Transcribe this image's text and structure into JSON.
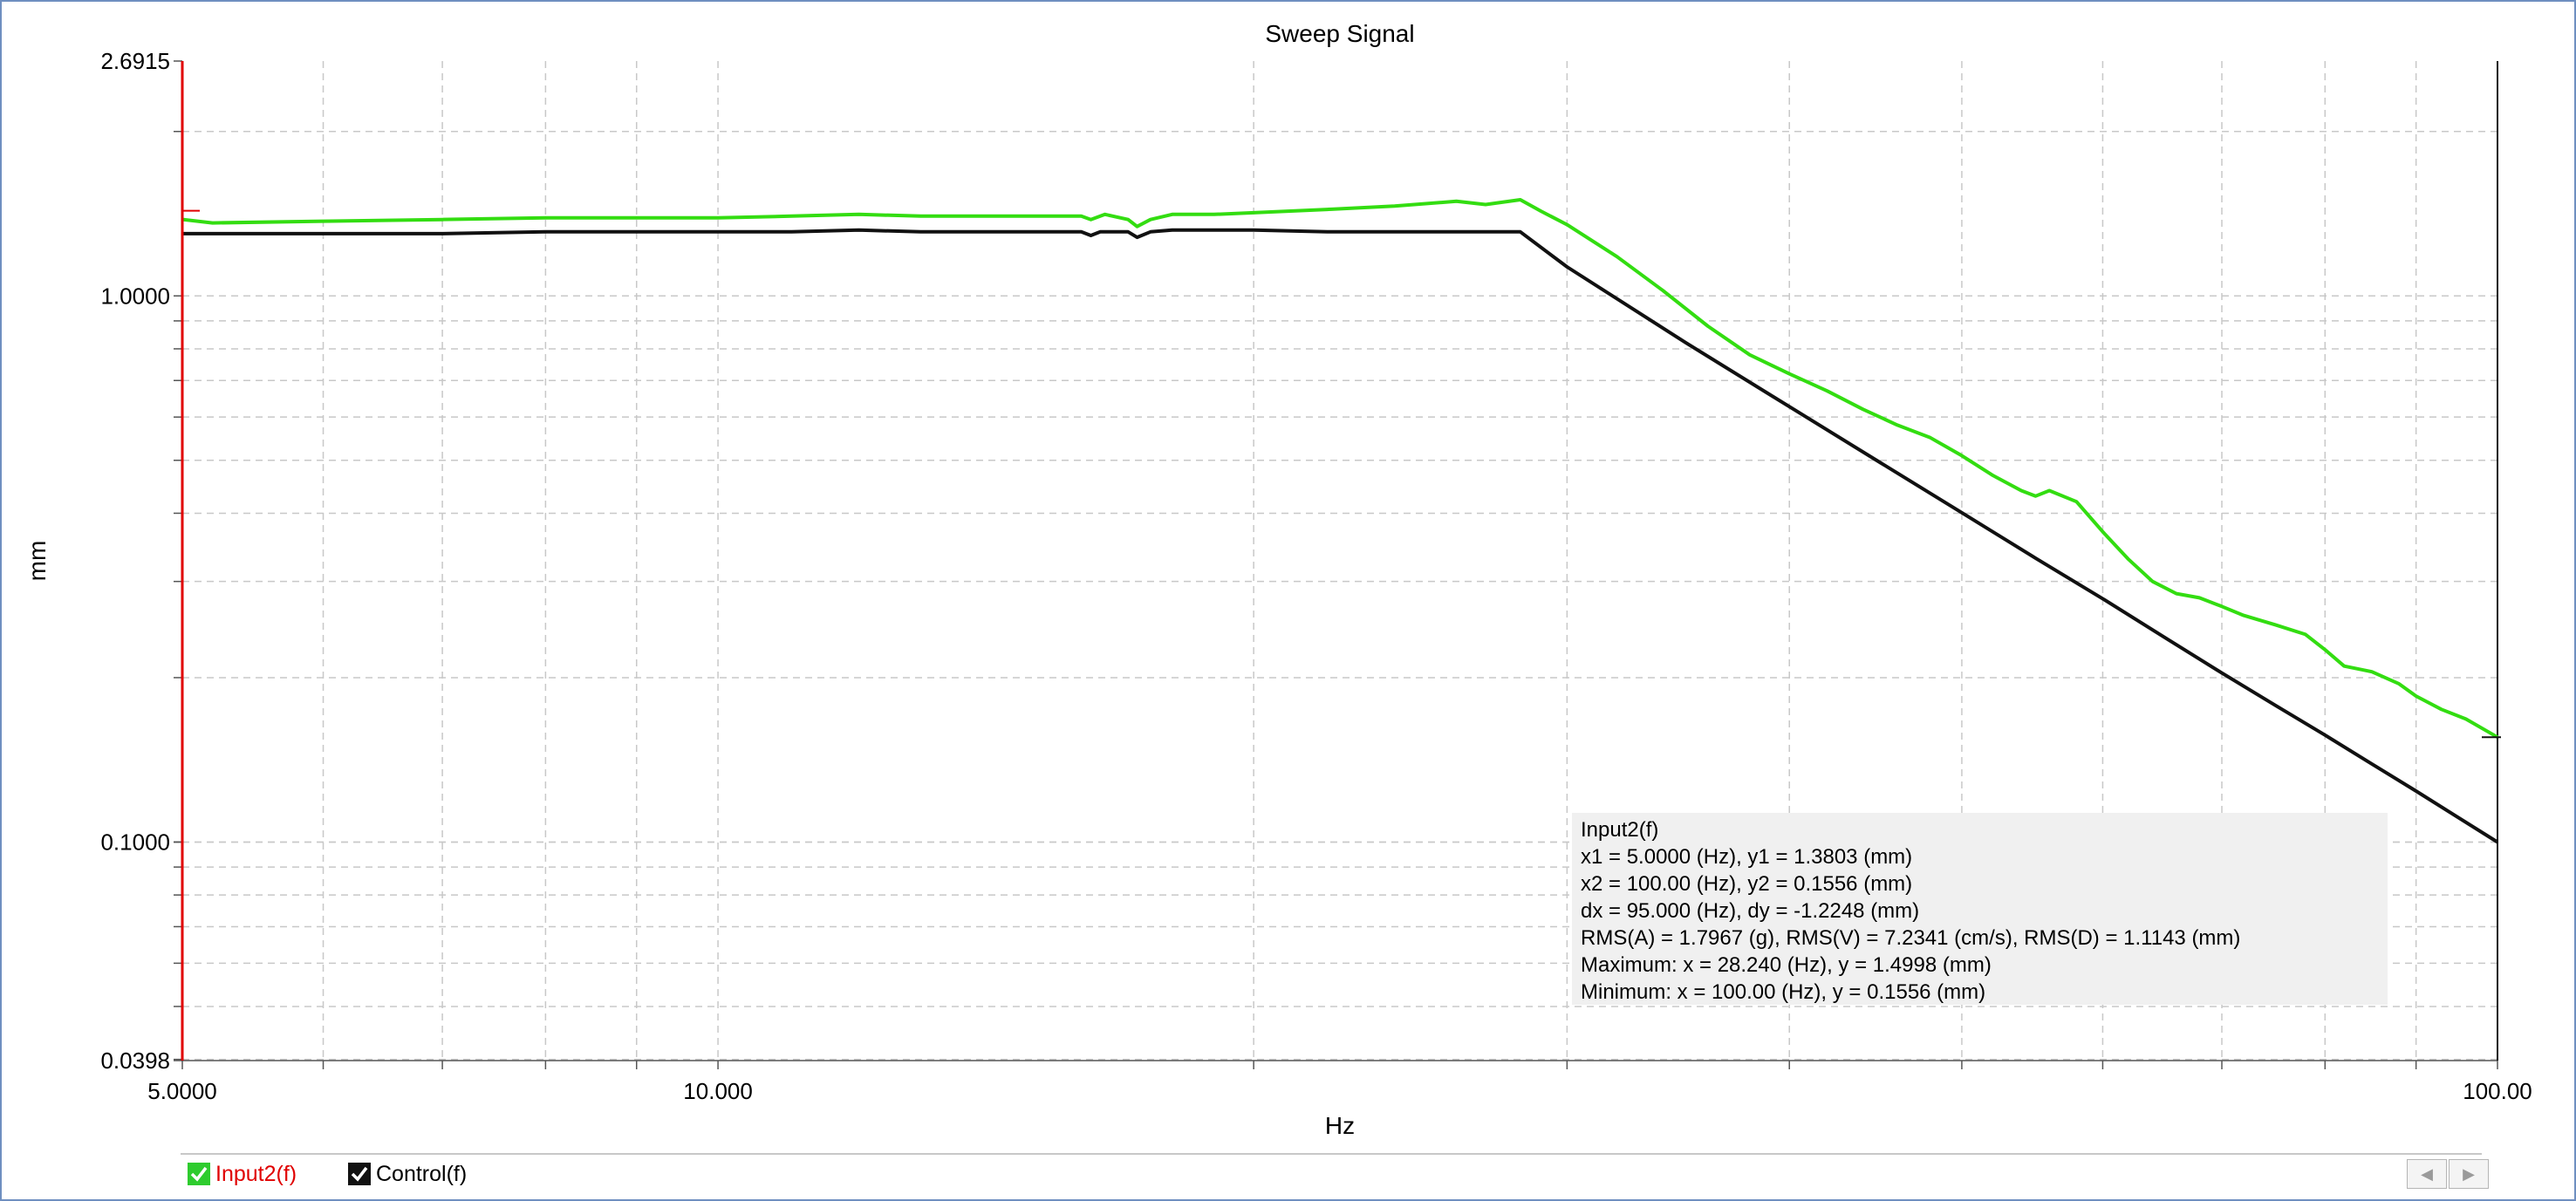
{
  "chart_data": {
    "type": "line",
    "title": "Sweep Signal",
    "xlabel": "Hz",
    "ylabel": "mm",
    "xscale": "log",
    "yscale": "log",
    "xlim": [
      5,
      100
    ],
    "ylim": [
      0.0398,
      2.6915
    ],
    "x_tick_labels": [
      "5.0000",
      "10.000",
      "100.00"
    ],
    "x_ticks": [
      5,
      10,
      100
    ],
    "y_tick_labels": [
      "2.6915",
      "1.0000",
      "0.1000",
      "0.0398"
    ],
    "y_ticks": [
      2.6915,
      1.0,
      0.1,
      0.0398
    ],
    "grid": true,
    "series": [
      {
        "name": "Input2(f)",
        "color": "#33dd11",
        "x": [
          5.0,
          5.2,
          6,
          7,
          8,
          9,
          10,
          11,
          12,
          13,
          14,
          15,
          16,
          16.2,
          16.5,
          17,
          17.2,
          17.5,
          18,
          19,
          20,
          22,
          24,
          26,
          27,
          28.24,
          29,
          30,
          32,
          34,
          36,
          38,
          40,
          42,
          44,
          46,
          48,
          50,
          52,
          54,
          55,
          56,
          58,
          60,
          62,
          64,
          66,
          68,
          70,
          72,
          75,
          78,
          80,
          82,
          85,
          88,
          90,
          93,
          96,
          100
        ],
        "y": [
          1.3803,
          1.36,
          1.37,
          1.38,
          1.39,
          1.39,
          1.39,
          1.4,
          1.41,
          1.4,
          1.4,
          1.4,
          1.4,
          1.38,
          1.41,
          1.38,
          1.34,
          1.38,
          1.41,
          1.41,
          1.42,
          1.44,
          1.46,
          1.49,
          1.47,
          1.4998,
          1.43,
          1.35,
          1.18,
          1.02,
          0.88,
          0.78,
          0.72,
          0.67,
          0.62,
          0.58,
          0.55,
          0.51,
          0.47,
          0.44,
          0.43,
          0.44,
          0.42,
          0.37,
          0.33,
          0.3,
          0.285,
          0.28,
          0.27,
          0.26,
          0.25,
          0.24,
          0.225,
          0.21,
          0.205,
          0.195,
          0.185,
          0.175,
          0.168,
          0.1556
        ]
      },
      {
        "name": "Control(f)",
        "color": "#111111",
        "x": [
          5.0,
          6,
          7,
          8,
          9,
          10,
          11,
          12,
          13,
          14,
          15,
          16,
          16.2,
          16.4,
          17,
          17.2,
          17.5,
          18,
          20,
          22,
          24,
          26,
          28.24,
          30,
          35,
          40,
          45,
          50,
          55,
          60,
          65,
          70,
          75,
          80,
          85,
          90,
          95,
          100
        ],
        "y": [
          1.3,
          1.3,
          1.3,
          1.31,
          1.31,
          1.31,
          1.31,
          1.32,
          1.31,
          1.31,
          1.31,
          1.31,
          1.29,
          1.31,
          1.31,
          1.28,
          1.31,
          1.32,
          1.32,
          1.31,
          1.31,
          1.31,
          1.31,
          1.13,
          0.82,
          0.627,
          0.495,
          0.401,
          0.331,
          0.279,
          0.237,
          0.204,
          0.178,
          0.157,
          0.139,
          0.124,
          0.111,
          0.1
        ]
      }
    ],
    "cursor_x": 5.0
  },
  "cursor_box": {
    "lines": [
      "Input2(f)",
      "x1 = 5.0000 (Hz), y1 = 1.3803 (mm)",
      "x2 = 100.00 (Hz), y2 = 0.1556 (mm)",
      "dx = 95.000 (Hz), dy = -1.2248 (mm)",
      "RMS(A) = 1.7967 (g), RMS(V) = 7.2341 (cm/s), RMS(D) = 1.1143 (mm)",
      "Maximum: x = 28.240 (Hz), y = 1.4998 (mm)",
      "Minimum: x = 100.00 (Hz), y = 0.1556 (mm)"
    ]
  },
  "legend": {
    "items": [
      {
        "label": "Input2(f)",
        "label_color": "#e00000",
        "box_color": "#2ecc2e"
      },
      {
        "label": "Control(f)",
        "label_color": "#000000",
        "box_color": "#111111"
      }
    ]
  },
  "scroll": {
    "left": "◀",
    "right": "▶"
  }
}
